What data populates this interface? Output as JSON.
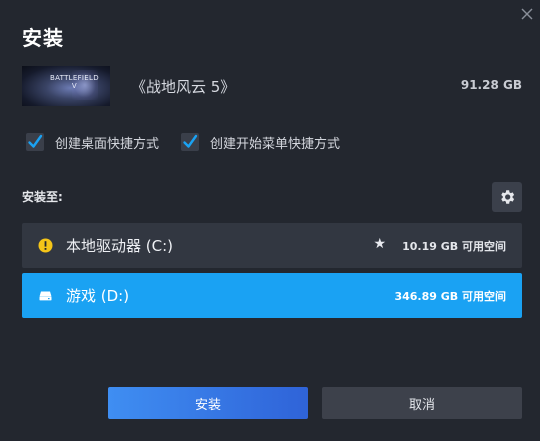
{
  "dialog": {
    "title": "安装",
    "close_icon": "close-icon"
  },
  "game": {
    "cover_text_line1": "BATTLEFIELD",
    "cover_text_line2": "V",
    "name": "《战地风云 5》",
    "size": "91.28 GB"
  },
  "options": {
    "desktop_shortcut": {
      "label": "创建桌面快捷方式",
      "checked": true
    },
    "start_menu_shortcut": {
      "label": "创建开始菜单快捷方式",
      "checked": true
    }
  },
  "install_location": {
    "label": "安装至:",
    "settings_icon": "gear-icon",
    "drives": [
      {
        "name": "本地驱动器 (C:)",
        "icon": "warning-icon",
        "starred": true,
        "free_space": "10.19 GB 可用空间",
        "selected": false
      },
      {
        "name": "游戏 (D:)",
        "icon": "drive-icon",
        "starred": false,
        "free_space": "346.89 GB 可用空间",
        "selected": true
      }
    ]
  },
  "buttons": {
    "install": "安装",
    "cancel": "取消"
  },
  "colors": {
    "accent": "#1aa2f3",
    "warning": "#f5c518",
    "background": "#23272f"
  }
}
